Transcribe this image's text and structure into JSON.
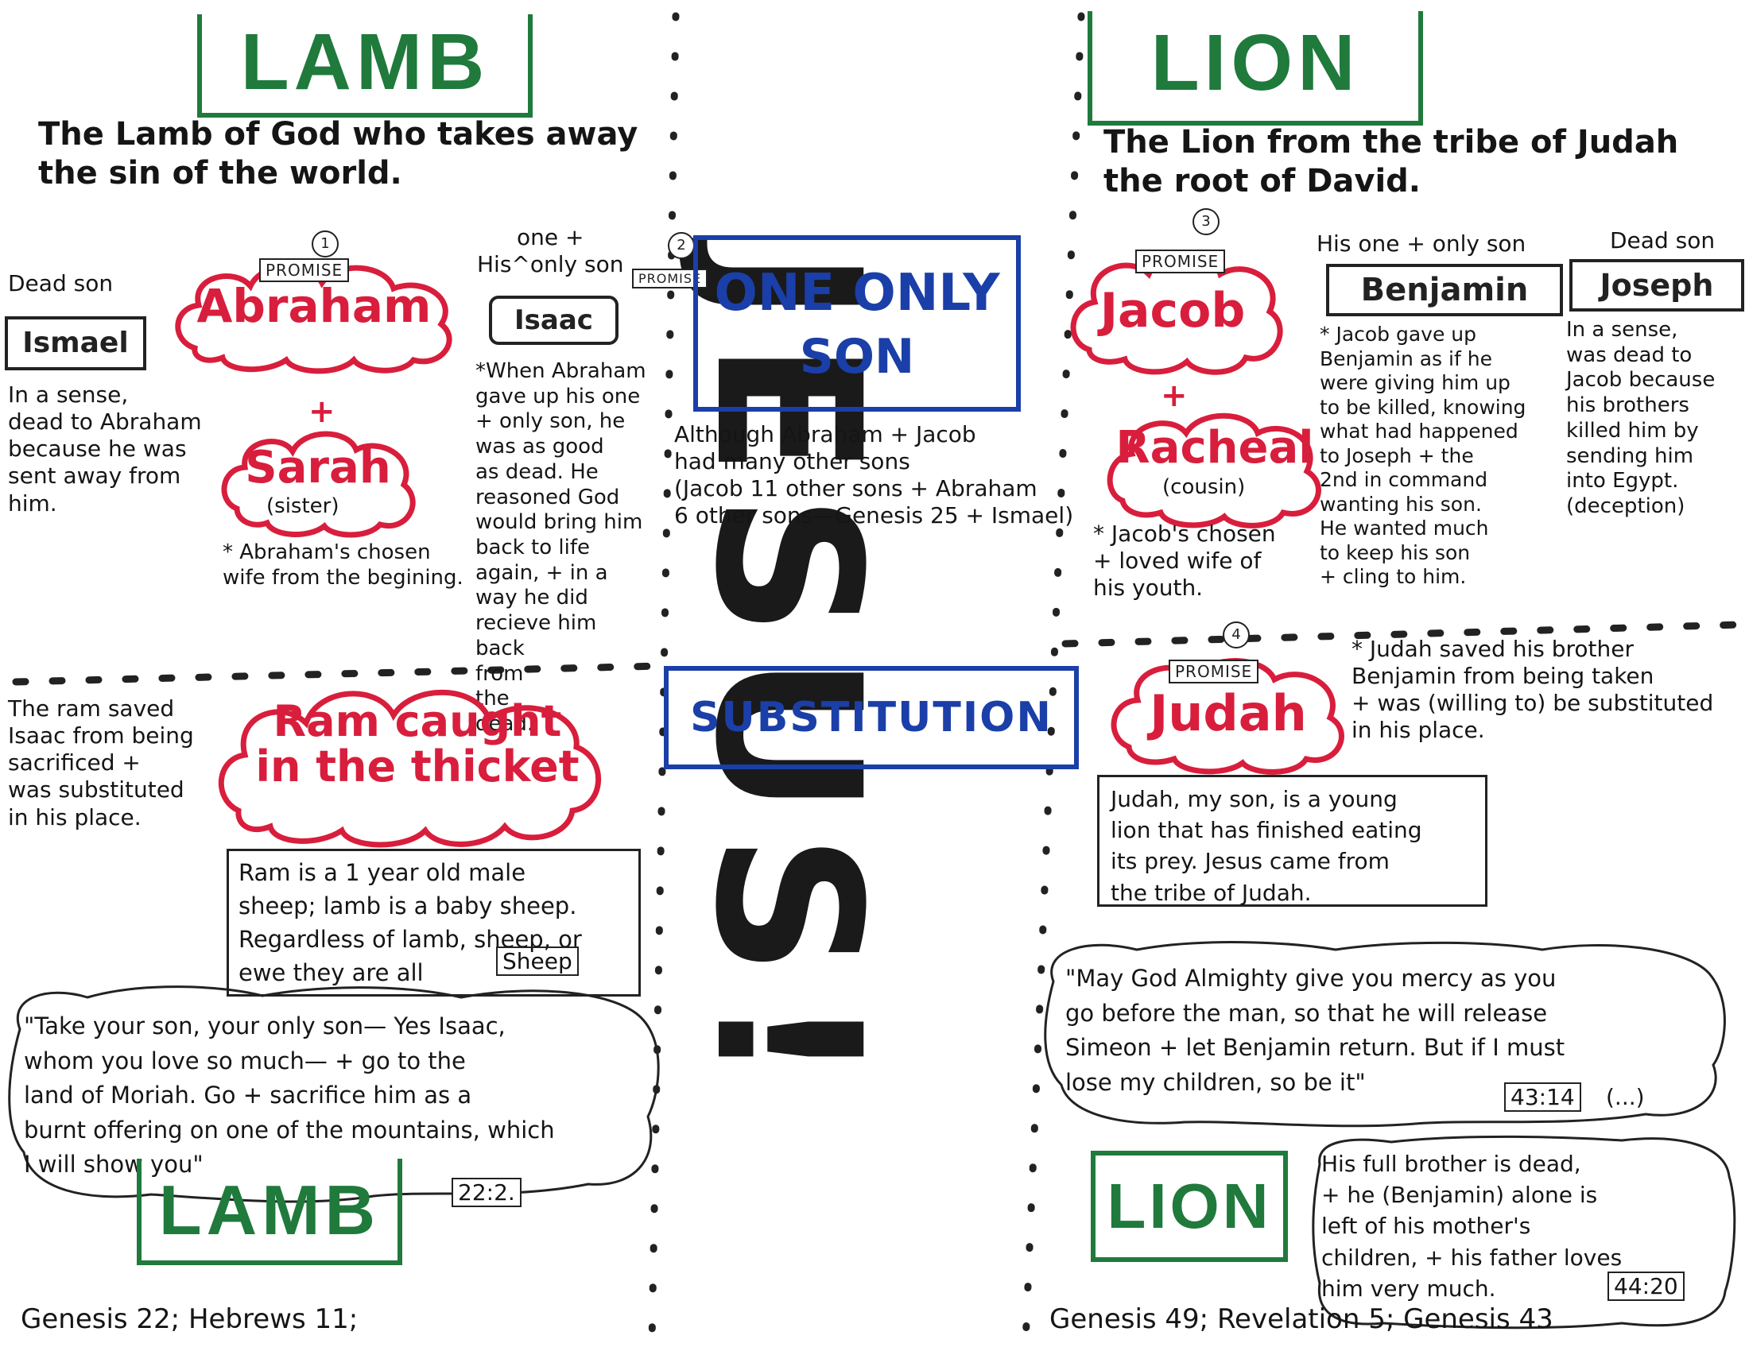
{
  "big_title": "JESUS!",
  "lamb_side": {
    "title": "LAMB",
    "subtitle": "The Lamb of God who takes away\nthe sin of the world.",
    "dead_son_label": "Dead son",
    "ismael": "Ismael",
    "ismael_note": "In a sense,\ndead to Abraham\nbecause he was\nsent away from\nhim.",
    "abraham": "Abraham",
    "abraham_num": "1",
    "promise": "PROMISE",
    "plus": "+",
    "sarah": "Sarah",
    "sarah_sub": "(sister)",
    "sarah_note": "* Abraham's chosen\nwife from the begining.",
    "isaac_label": "one +\nHis^only son",
    "isaac": "Isaac",
    "isaac_num": "2",
    "isaac_note": "*When Abraham\ngave up his one\n+ only son, he\nwas as good\nas dead. He\nreasoned God\nwould bring him\nback to life\nagain, + in a\nway he did\nrecieve him\nback\nfrom\nthe\ndead.",
    "ram_note": "The ram saved\nIsaac from being\nsacrificed +\nwas substituted\nin his place.",
    "ram": "Ram caught\nin the thicket",
    "ram_box": "Ram is a 1 year old male\nsheep; lamb is a baby sheep.\nRegardless of lamb, sheep, or\newe they are all",
    "sheep": "Sheep",
    "quote": "\"Take your son, your only son— Yes Isaac,\nwhom you love so much— + go to the\nland of Moriah. Go + sacrifice him as a\nburnt offering on one of the mountains, which\nI will show you\"",
    "quote_ref": "22:2.",
    "bottom_title": "LAMB",
    "footer": "Genesis 22; Hebrews 11;"
  },
  "center": {
    "one_only": "ONE ONLY",
    "son": "SON",
    "although": "Although Abraham + Jacob\nhad many other sons\n(Jacob 11 other sons + Abraham\n6 other sons—Genesis 25 + Ismael)",
    "substitution": "SUBSTITUTION"
  },
  "lion_side": {
    "title": "LION",
    "subtitle": "The Lion from the tribe of Judah\nthe root of David.",
    "jacob": "Jacob",
    "jacob_num": "3",
    "promise": "PROMISE",
    "plus": "+",
    "racheal": "Racheal",
    "racheal_sub": "(cousin)",
    "racheal_note": "* Jacob's chosen\n+ loved wife of\nhis youth.",
    "benjamin_label": "His one + only son",
    "benjamin": "Benjamin",
    "benjamin_note": "* Jacob gave up\nBenjamin as if he\nwere giving him up\nto be killed, knowing\nwhat had happened\nto Joseph + the\n2nd in command\nwanting his son.\nHe wanted much\nto keep his son\n+ cling to him.",
    "dead_son_label": "Dead son",
    "joseph": "Joseph",
    "joseph_note": "In a sense,\nwas dead to\nJacob because\nhis brothers\nkilled him by\nsending him\ninto Egypt.\n(deception)",
    "judah": "Judah",
    "judah_num": "4",
    "judah_note": "* Judah saved his brother\nBenjamin from being taken\n+ was (willing to) be substituted\nin his place.",
    "judah_box": "Judah, my son, is a young\nlion that has finished eating\nits prey. Jesus came from\nthe tribe of Judah.",
    "quote": "\"May God Almighty give you mercy as you\ngo before the man, so that he will release\nSimeon + let Benjamin return. But if I must\nlose my children, so be it\"",
    "quote_ref": "43:14",
    "quote_tail": "(...)",
    "bottom_title": "LION",
    "brother_box": "His full brother is dead,\n+ he (Benjamin) alone is\nleft of his mother's\nchildren, + his father loves\nhim very much.",
    "brother_ref": "44:20",
    "footer": "Genesis 49; Revelation 5; Genesis 43"
  },
  "colors": {
    "green": "#1f7a3c",
    "red": "#d81e3c",
    "blue": "#1b3fa8",
    "black": "#1a1a1a"
  }
}
